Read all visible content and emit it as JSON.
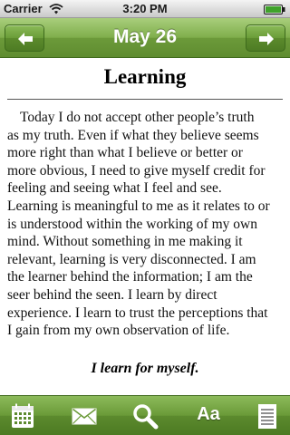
{
  "status_bar": {
    "carrier": "Carrier",
    "time": "3:20 PM"
  },
  "nav": {
    "title": "May 26",
    "prev_icon": "arrow-left-icon",
    "next_icon": "arrow-right-icon"
  },
  "article": {
    "title": "Learning",
    "lines": [
      "Today I do not accept other people’s truth",
      "as my truth. Even if what they believe seems",
      "more right than what I believe or better or",
      "more obvious, I need to give myself credit for",
      "feeling and seeing what I feel and see.",
      "Learning is meaningful to me as it relates to or",
      "is understood within the working of my own",
      "mind. Without something in me making it",
      "relevant, learning is very disconnected. I am",
      "the learner behind the information; I am the",
      "seer behind the seen. I learn by direct",
      "experience. I learn to trust the perceptions that",
      "I gain from my own observation of life."
    ],
    "affirmation": "I learn for myself."
  },
  "tab_bar": {
    "items": [
      {
        "icon": "calendar-icon"
      },
      {
        "icon": "mail-icon"
      },
      {
        "icon": "search-icon"
      },
      {
        "icon": "font-size-icon",
        "label": "Aa"
      },
      {
        "icon": "notes-icon"
      }
    ]
  },
  "colors": {
    "bar_green": "#6c9a3a",
    "bar_green_light": "#a9ce7c",
    "text": "#111111"
  }
}
